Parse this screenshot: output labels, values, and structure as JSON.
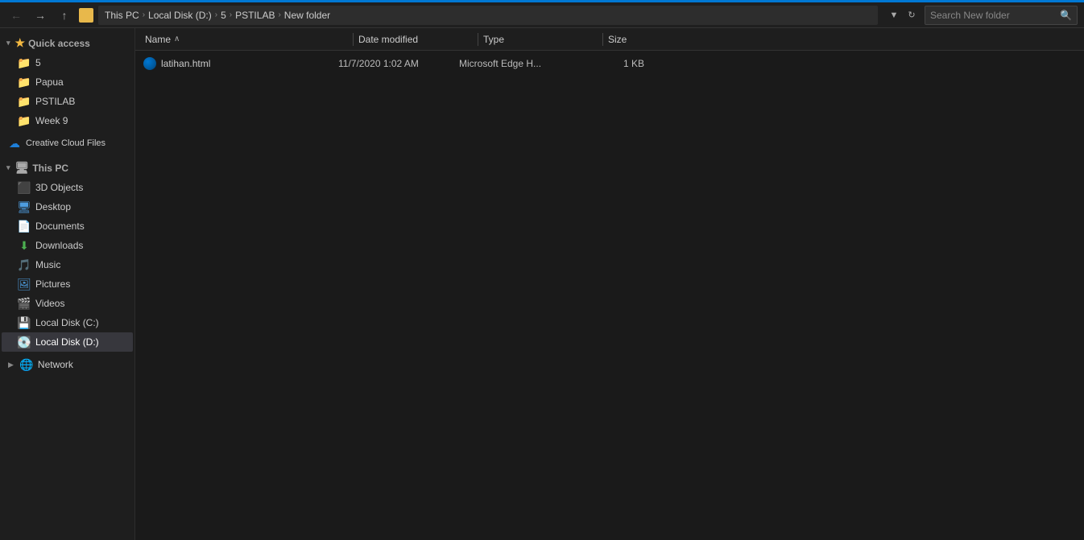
{
  "titlebar": {
    "back_label": "←",
    "forward_label": "→",
    "up_label": "↑",
    "breadcrumb": [
      {
        "label": "This PC",
        "sep": "›"
      },
      {
        "label": "Local Disk (D:)",
        "sep": "›"
      },
      {
        "label": "5",
        "sep": "›"
      },
      {
        "label": "PSTILAB",
        "sep": "›"
      },
      {
        "label": "New folder",
        "sep": ""
      }
    ],
    "dropdown_label": "▼",
    "refresh_label": "↻",
    "search_placeholder": "Search New folder",
    "search_icon": "🔍"
  },
  "sidebar": {
    "quick_access_label": "Quick access",
    "quick_access_items": [
      {
        "label": "5",
        "icon": "folder"
      },
      {
        "label": "Papua",
        "icon": "folder"
      },
      {
        "label": "PSTILAB",
        "icon": "folder"
      },
      {
        "label": "Week 9",
        "icon": "folder"
      }
    ],
    "cloud_label": "Creative Cloud Files",
    "this_pc_label": "This PC",
    "this_pc_items": [
      {
        "label": "3D Objects",
        "icon": "3d"
      },
      {
        "label": "Desktop",
        "icon": "desktop"
      },
      {
        "label": "Documents",
        "icon": "docs"
      },
      {
        "label": "Downloads",
        "icon": "downloads"
      },
      {
        "label": "Music",
        "icon": "music"
      },
      {
        "label": "Pictures",
        "icon": "pics"
      },
      {
        "label": "Videos",
        "icon": "videos"
      },
      {
        "label": "Local Disk (C:)",
        "icon": "drive"
      },
      {
        "label": "Local Disk (D:)",
        "icon": "drive",
        "active": true
      }
    ],
    "network_label": "Network"
  },
  "columns": {
    "name_label": "Name",
    "sort_arrow": "∧",
    "date_label": "Date modified",
    "type_label": "Type",
    "size_label": "Size"
  },
  "files": [
    {
      "name": "latihan.html",
      "icon": "edge",
      "date": "11/7/2020 1:02 AM",
      "type": "Microsoft Edge H...",
      "size": "1 KB"
    }
  ]
}
